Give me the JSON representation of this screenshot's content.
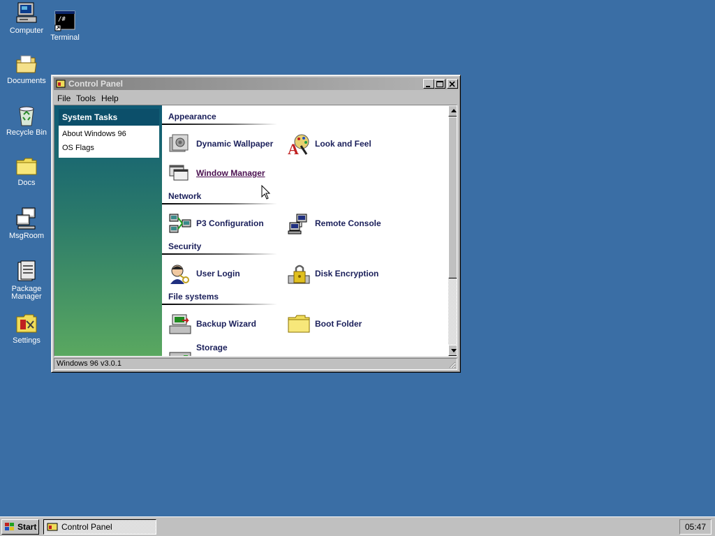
{
  "desktop": {
    "icons": [
      {
        "label": "Computer",
        "icon": "computer-icon"
      },
      {
        "label": "Terminal",
        "icon": "terminal-icon"
      },
      {
        "label": "Documents",
        "icon": "documents-folder-icon"
      },
      {
        "label": "Recycle Bin",
        "icon": "recycle-bin-icon"
      },
      {
        "label": "Docs",
        "icon": "folder-icon"
      },
      {
        "label": "MsgRoom",
        "icon": "msgroom-icon"
      },
      {
        "label": "Package Manager",
        "icon": "package-manager-icon"
      },
      {
        "label": "Settings",
        "icon": "settings-icon"
      }
    ]
  },
  "window": {
    "title": "Control Panel",
    "menu": [
      "File",
      "Tools",
      "Help"
    ],
    "status": "Windows 96 v3.0.1"
  },
  "sidebar": {
    "heading": "System Tasks",
    "links": [
      "About Windows 96",
      "OS Flags"
    ]
  },
  "sections": [
    {
      "title": "Appearance",
      "items": [
        {
          "label": "Dynamic Wallpaper",
          "icon": "wallpaper-icon"
        },
        {
          "label": "Look and Feel",
          "icon": "look-and-feel-icon"
        },
        {
          "label": "Window Manager",
          "icon": "window-manager-icon",
          "hovered": true
        }
      ]
    },
    {
      "title": "Network",
      "items": [
        {
          "label": "P3 Configuration",
          "icon": "network-computers-icon"
        },
        {
          "label": "Remote Console",
          "icon": "remote-console-icon"
        }
      ]
    },
    {
      "title": "Security",
      "items": [
        {
          "label": "User Login",
          "icon": "user-key-icon"
        },
        {
          "label": "Disk Encryption",
          "icon": "lock-drive-icon"
        }
      ]
    },
    {
      "title": "File systems",
      "items": [
        {
          "label": "Backup Wizard",
          "icon": "backup-drive-icon"
        },
        {
          "label": "Boot Folder",
          "icon": "folder-icon"
        },
        {
          "label": "Storage",
          "icon": "storage-drive-icon"
        }
      ]
    }
  ],
  "taskbar": {
    "start_label": "Start",
    "tasks": [
      {
        "label": "Control Panel"
      }
    ],
    "clock": "05:47"
  },
  "colors": {
    "desktop": "#3a6ea5",
    "section_text": "#1a1f5a",
    "sidebar_top": "#0e5a75",
    "sidebar_bottom": "#5aa860"
  }
}
